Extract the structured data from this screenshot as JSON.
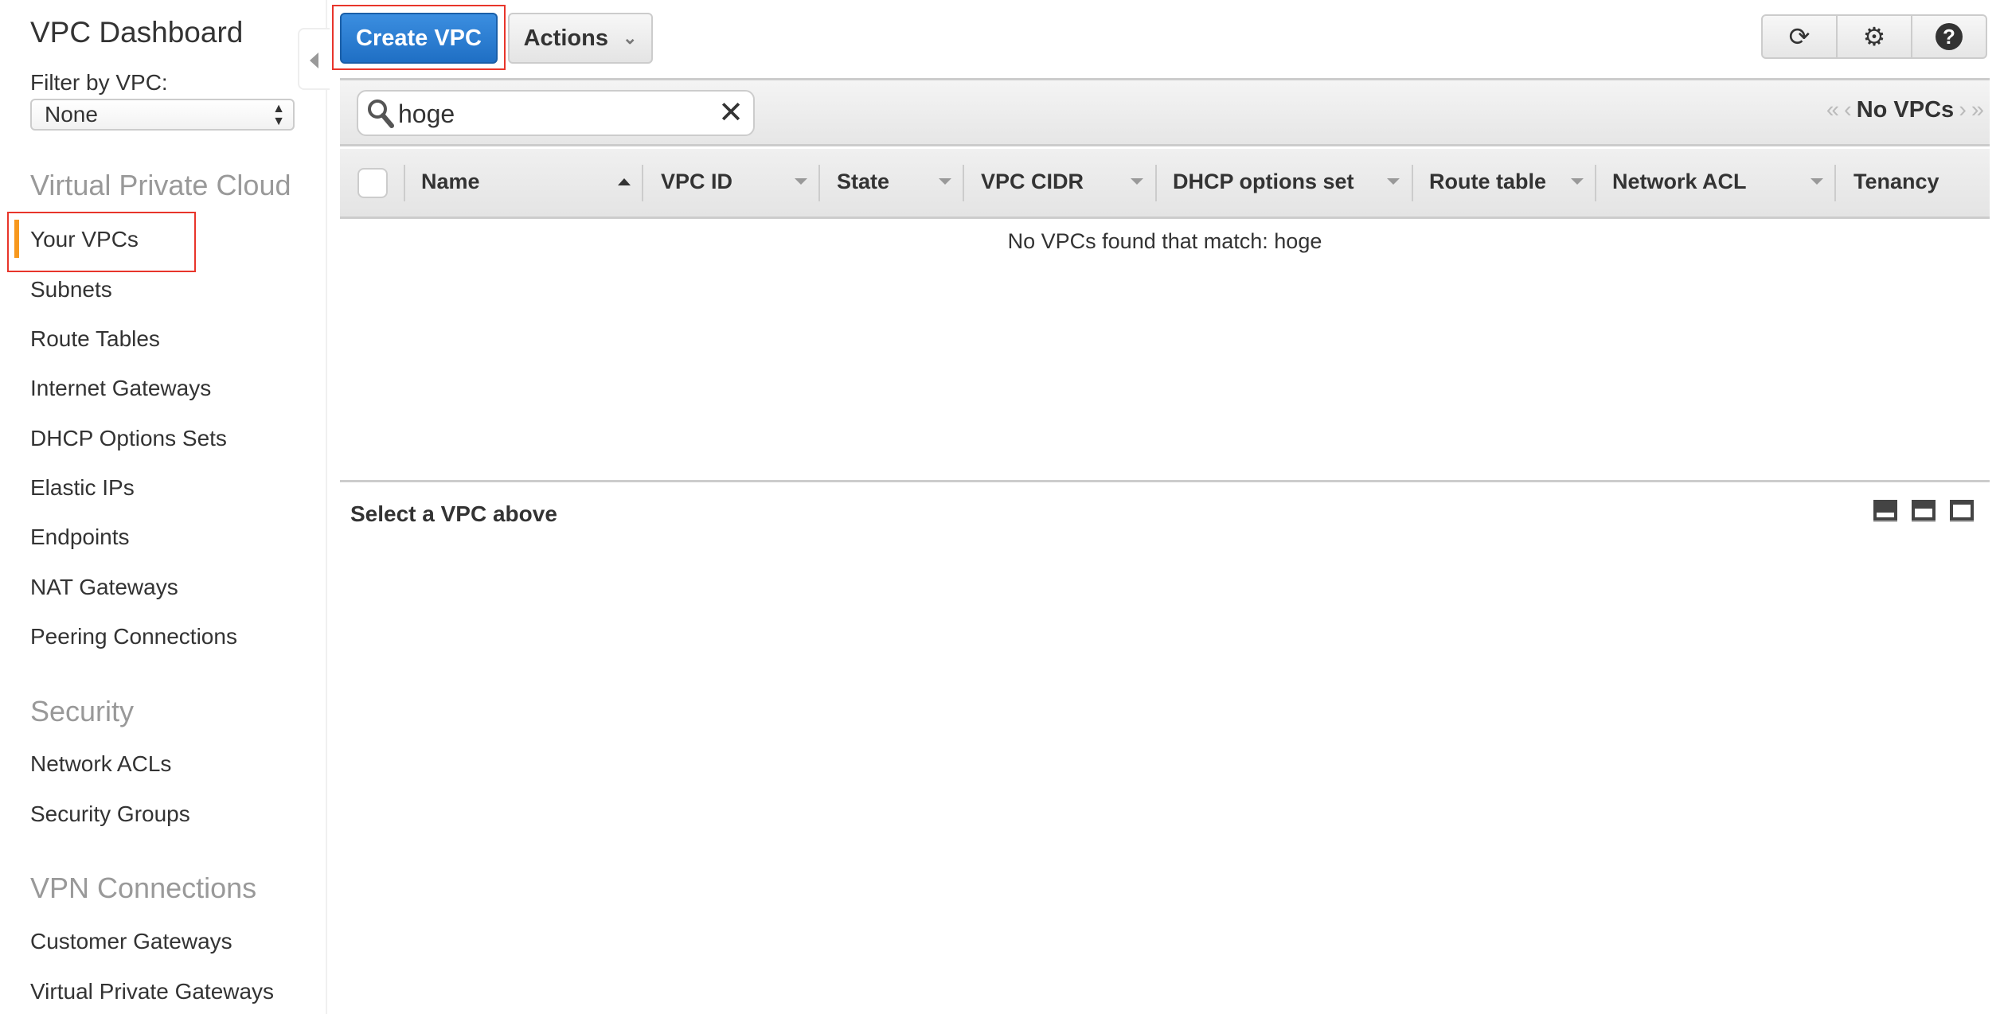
{
  "sidebar": {
    "title": "VPC Dashboard",
    "filter_label": "Filter by VPC:",
    "filter_value": "None",
    "sections": [
      {
        "heading": "Virtual Private Cloud",
        "items": [
          "Your VPCs",
          "Subnets",
          "Route Tables",
          "Internet Gateways",
          "DHCP Options Sets",
          "Elastic IPs",
          "Endpoints",
          "NAT Gateways",
          "Peering Connections"
        ]
      },
      {
        "heading": "Security",
        "items": [
          "Network ACLs",
          "Security Groups"
        ]
      },
      {
        "heading": "VPN Connections",
        "items": [
          "Customer Gateways",
          "Virtual Private Gateways"
        ]
      }
    ],
    "active_item": "Your VPCs"
  },
  "toolbar": {
    "create_label": "Create VPC",
    "actions_label": "Actions",
    "icons": [
      "refresh-icon",
      "gear-icon",
      "help-icon"
    ]
  },
  "search": {
    "value": "hoge"
  },
  "pager": {
    "label": "No VPCs"
  },
  "table": {
    "columns": [
      "Name",
      "VPC ID",
      "State",
      "VPC CIDR",
      "DHCP options set",
      "Route table",
      "Network ACL",
      "Tenancy"
    ],
    "empty_message": "No VPCs found that match: hoge"
  },
  "details": {
    "title": "Select a VPC above"
  },
  "colors": {
    "primary": "#2479d0",
    "active_indicator": "#f7981d",
    "highlight_box": "#e8352b"
  }
}
